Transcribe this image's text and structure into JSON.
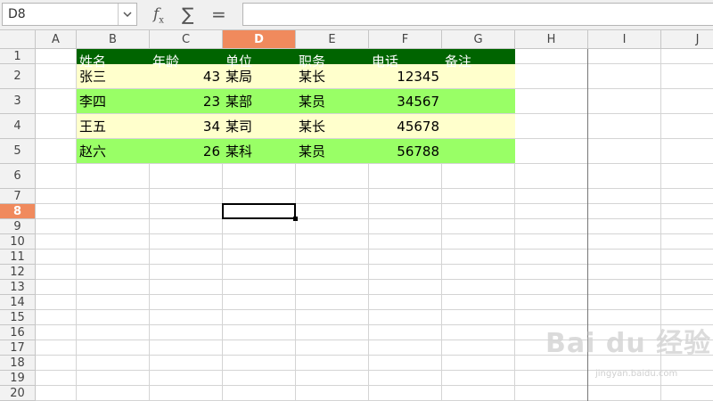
{
  "formula_bar": {
    "cell_reference": "D8",
    "formula": ""
  },
  "columns": [
    "A",
    "B",
    "C",
    "D",
    "E",
    "F",
    "G",
    "H",
    "I",
    "J"
  ],
  "active_column": "D",
  "rows": [
    "1",
    "2",
    "3",
    "4",
    "5",
    "6",
    "7",
    "8",
    "9",
    "10",
    "11",
    "12",
    "13",
    "14",
    "15",
    "16",
    "17",
    "18",
    "19",
    "20"
  ],
  "active_row": "8",
  "table": {
    "headers": [
      "姓名",
      "年龄",
      "单位",
      "职务",
      "电话",
      "备注"
    ],
    "records": [
      [
        "张三",
        "43",
        "某局",
        "某长",
        "12345",
        ""
      ],
      [
        "李四",
        "23",
        "某部",
        "某员",
        "34567",
        ""
      ],
      [
        "王五",
        "34",
        "某司",
        "某长",
        "45678",
        ""
      ],
      [
        "赵六",
        "26",
        "某科",
        "某员",
        "56788",
        ""
      ]
    ]
  },
  "colors": {
    "header_fill": "#006400",
    "row_light": "#ffffcc",
    "row_green": "#99ff66",
    "active_header": "#f08a5d"
  },
  "watermark": {
    "text": "Bai du 经验",
    "sub": "jingyan.baidu.com"
  }
}
